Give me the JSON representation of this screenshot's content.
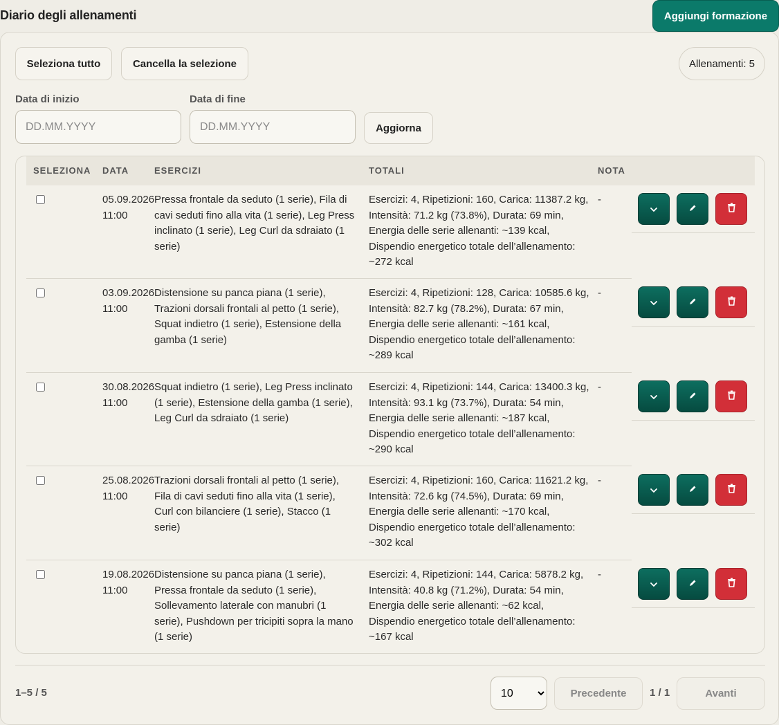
{
  "header": {
    "title": "Diario degli allenamenti",
    "add_label": "Aggiungi formazione"
  },
  "toolbar": {
    "select_all": "Seleziona tutto",
    "clear_selection": "Cancella la selezione",
    "count": "Allenamenti: 5"
  },
  "filters": {
    "start_label": "Data di inizio",
    "start_placeholder": "DD.MM.YYYY",
    "end_label": "Data di fine",
    "end_placeholder": "DD.MM.YYYY",
    "refresh": "Aggiorna"
  },
  "table": {
    "headers": [
      "SELEZIONA",
      "DATA",
      "ESERCIZI",
      "TOTALI",
      "NOTA"
    ],
    "rows": [
      {
        "date": "05.09.2026 11:00",
        "exercises": "Pressa frontale da seduto (1 serie), Fila di cavi seduti fino alla vita (1 serie), Leg Press inclinato (1 serie), Leg Curl da sdraiato (1 serie)",
        "totals": "Esercizi: 4, Ripetizioni: 160, Carica: 11387.2 kg, Intensità: 71.2 kg (73.8%), Durata: 69 min, Energia delle serie allenanti: ~139 kcal, Dispendio energetico totale dell’allenamento: ~272 kcal",
        "note": "-"
      },
      {
        "date": "03.09.2026 11:00",
        "exercises": "Distensione su panca piana (1 serie), Trazioni dorsali frontali al petto (1 serie), Squat indietro (1 serie), Estensione della gamba (1 serie)",
        "totals": "Esercizi: 4, Ripetizioni: 128, Carica: 10585.6 kg, Intensità: 82.7 kg (78.2%), Durata: 67 min, Energia delle serie allenanti: ~161 kcal, Dispendio energetico totale dell’allenamento: ~289 kcal",
        "note": "-"
      },
      {
        "date": "30.08.2026 11:00",
        "exercises": "Squat indietro (1 serie), Leg Press inclinato (1 serie), Estensione della gamba (1 serie), Leg Curl da sdraiato (1 serie)",
        "totals": "Esercizi: 4, Ripetizioni: 144, Carica: 13400.3 kg, Intensità: 93.1 kg (73.7%), Durata: 54 min, Energia delle serie allenanti: ~187 kcal, Dispendio energetico totale dell’allenamento: ~290 kcal",
        "note": "-"
      },
      {
        "date": "25.08.2026 11:00",
        "exercises": "Trazioni dorsali frontali al petto (1 serie), Fila di cavi seduti fino alla vita (1 serie), Curl con bilanciere (1 serie), Stacco (1 serie)",
        "totals": "Esercizi: 4, Ripetizioni: 160, Carica: 11621.2 kg, Intensità: 72.6 kg (74.5%), Durata: 69 min, Energia delle serie allenanti: ~170 kcal, Dispendio energetico totale dell’allenamento: ~302 kcal",
        "note": "-"
      },
      {
        "date": "19.08.2026 11:00",
        "exercises": "Distensione su panca piana (1 serie), Pressa frontale da seduto (1 serie), Sollevamento laterale con manubri (1 serie), Pushdown per tricipiti sopra la mano (1 serie)",
        "totals": "Esercizi: 4, Ripetizioni: 144, Carica: 5878.2 kg, Intensità: 40.8 kg (71.2%), Durata: 54 min, Energia delle serie allenanti: ~62 kcal, Dispendio energetico totale dell’allenamento: ~167 kcal",
        "note": "-"
      }
    ],
    "icons": {
      "expand": "chevron-down-icon",
      "edit": "pencil-icon",
      "delete": "trash-icon"
    }
  },
  "pagination": {
    "range": "1–5 / 5",
    "page_size": "10",
    "page_size_options": [
      "10"
    ],
    "prev": "Precedente",
    "page_info": "1 / 1",
    "next": "Avanti"
  },
  "colors": {
    "accent": "#0b7a6a",
    "danger": "#d22f38",
    "background": "#efede6"
  }
}
